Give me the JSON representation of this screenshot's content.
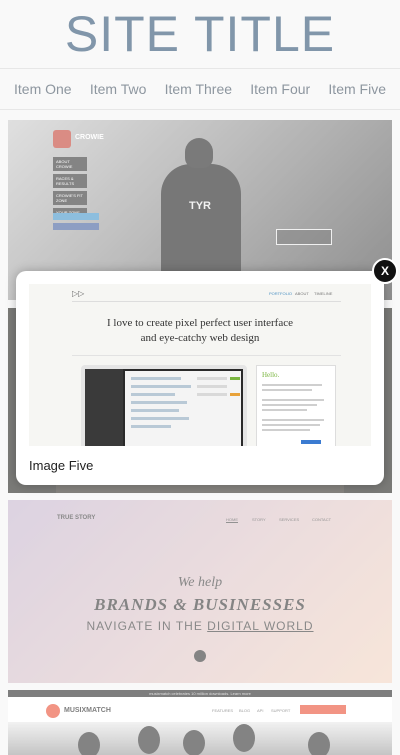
{
  "site": {
    "title": "SITE TITLE"
  },
  "nav": {
    "items": [
      "Item One",
      "Item Two",
      "Item Three",
      "Item Four",
      "Item Five"
    ]
  },
  "thumbs": {
    "crowie": {
      "brand": "CROWIE",
      "menu": [
        "ABOUT CROWIE",
        "RACES & RESULTS",
        "CROWIE'S FIT ZONE",
        "YOUR ZONE"
      ],
      "shirt_text": "TYR"
    },
    "truestory": {
      "brand": "TRUE STORY",
      "menu": [
        "HOME",
        "STORY",
        "SERVICES",
        "CONTACT"
      ],
      "line1": "We help",
      "line2": "BRANDS & BUSINESSES",
      "line3_a": "NAVIGATE IN THE ",
      "line3_b": "DIGITAL WORLD"
    },
    "musixmatch": {
      "bar_text": "musixmatch celebrates 10 million downloads. Learn more",
      "brand": "MUSIXMATCH",
      "menu": [
        "FEATURES",
        "BLOG",
        "API",
        "SUPPORT"
      ]
    }
  },
  "modal": {
    "close_label": "X",
    "caption": "Image Five",
    "preview": {
      "nav": [
        "PORTFOLIO",
        "ABOUT",
        "TIMELINE"
      ],
      "headline_1": "I love to create pixel perfect user interface",
      "headline_2": "and eye-catchy web design",
      "hello": "Hello."
    }
  },
  "colors": {
    "title": "#274b6d",
    "nav_text": "#3b4a5a",
    "accent_green": "#7bb641",
    "accent_orange": "#e8472c",
    "crowie_red": "#c0392b"
  }
}
